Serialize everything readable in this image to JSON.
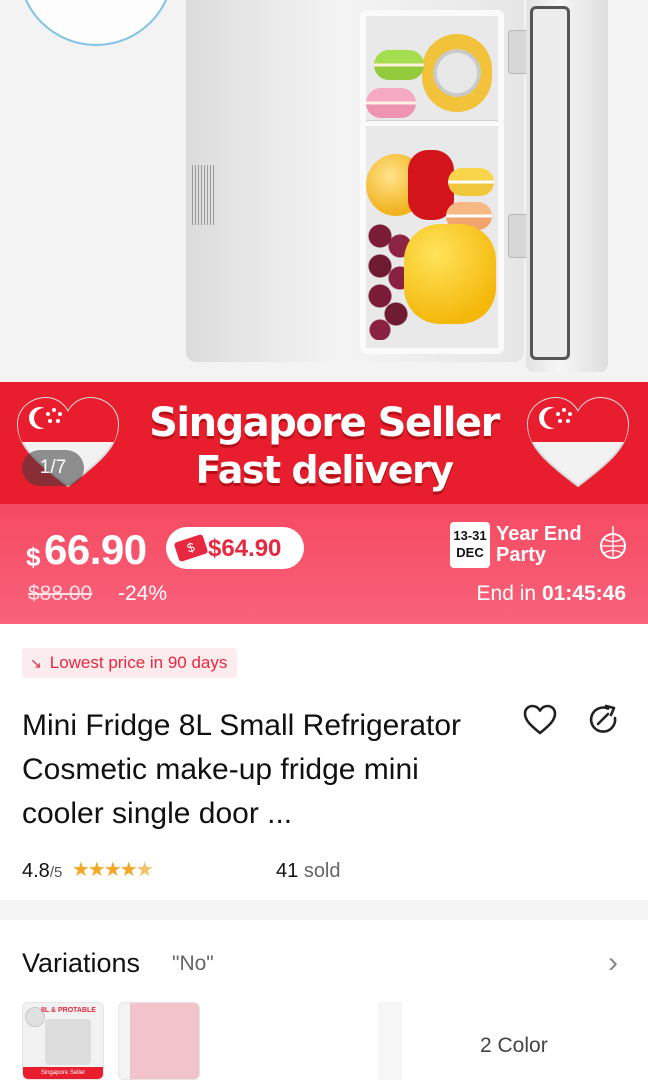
{
  "gallery": {
    "counter": "1/7"
  },
  "banner": {
    "line1": "Singapore Seller",
    "line2": "Fast delivery"
  },
  "price": {
    "currency": "$",
    "amount": "66.90",
    "voucher_price": "$64.90",
    "original_price": "$88.00",
    "discount": "-24%",
    "promo": {
      "date_range": "13-31",
      "month": "DEC",
      "title_line1": "Year End",
      "title_line2": "Party"
    },
    "countdown_label": "End in",
    "countdown_time": "01:45:46"
  },
  "product": {
    "lowest_price_tag": "Lowest price in 90 days",
    "title": "Mini Fridge 8L Small Refrigerator Cosmetic make-up fridge mini cooler single door ...",
    "rating": "4.8",
    "rating_max": "/5",
    "stars": 4.8,
    "sold_count": "41",
    "sold_label": "sold"
  },
  "variations": {
    "title": "Variations",
    "selected": "\"No\"",
    "count_label": "2 Color",
    "thumb1_label": "8L & PROTABLE",
    "thumb1_band": "Singapore Seller"
  },
  "colors": {
    "brand_red": "#e81d2d",
    "price_bar": "#f54a62",
    "star": "#f5a623"
  },
  "icons": [
    "heart-outline-icon",
    "share-icon",
    "chevron-right-icon",
    "trend-down-icon",
    "voucher-icon",
    "disco-ball-icon",
    "singapore-heart-flag-icon"
  ]
}
